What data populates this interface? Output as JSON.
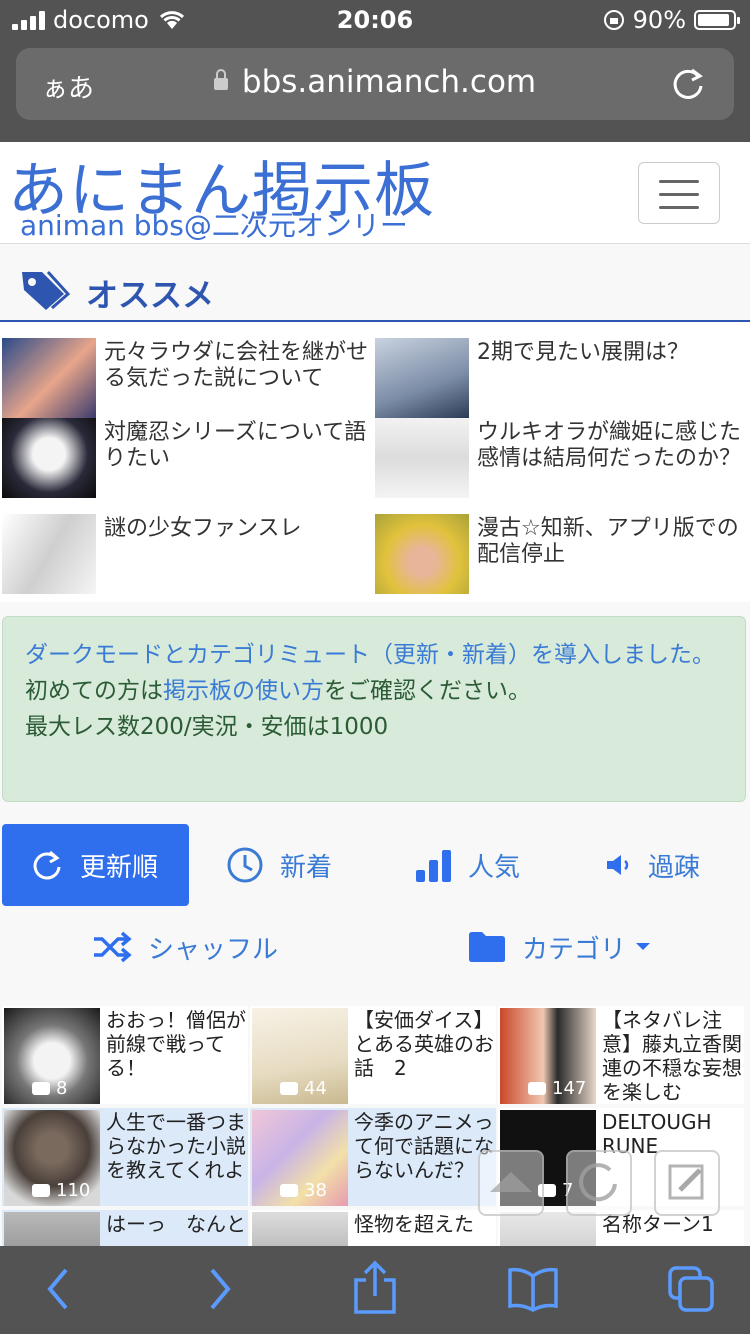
{
  "status": {
    "carrier": "docomo",
    "time": "20:06",
    "battery": "90%",
    "battery_level": 0.9
  },
  "safari": {
    "aa": "ぁあ",
    "url": "bbs.animanch.com"
  },
  "site": {
    "logo_ja": "あにまん掲示板",
    "logo_en": "animan bbs@二次元オンリー"
  },
  "recommended": {
    "heading": "オススメ",
    "items": [
      {
        "title": "元々ラウダに会社を継がせる気だった説について"
      },
      {
        "title": "2期で見たい展開は？"
      },
      {
        "title": "対魔忍シリーズについて語りたい"
      },
      {
        "title": "ウルキオラが織姫に感じた感情は結局何だったのか？"
      },
      {
        "title": "謎の少女ファンスレ"
      },
      {
        "title": "漫古☆知新、アプリ版での配信停止"
      }
    ]
  },
  "notice": {
    "line1": "ダークモードとカテゴリミュート（更新・新着）を導入しました。",
    "line2_pre": "初めての方は",
    "line2_link": "掲示板の使い方",
    "line2_post": "をご確認ください。",
    "line3": "最大レス数200/実況・安価は1000"
  },
  "sort": {
    "update": "更新順",
    "new": "新着",
    "popular": "人気",
    "sparse": "過疎",
    "shuffle": "シャッフル",
    "category": "カテゴリ"
  },
  "threads": [
    {
      "title": "おおっ！僧侶が前線で戦ってる！",
      "count": "8"
    },
    {
      "title": "【安価ダイス】とある英雄のお話　2",
      "count": "44"
    },
    {
      "title": "【ネタバレ注意】藤丸立香関連の不穏な妄想を楽しむ",
      "count": "147"
    },
    {
      "title": "人生で一番つまらなかった小説を教えてくれよ",
      "count": "110"
    },
    {
      "title": "今季のアニメって何で話題にならないんだ？",
      "count": "38"
    },
    {
      "title": "DELTOUGH RUNE",
      "count": "7"
    },
    {
      "title": "はーっ　なんと",
      "count": ""
    },
    {
      "title": "怪物を超えた",
      "count": ""
    },
    {
      "title": "名称ターン1",
      "count": ""
    }
  ],
  "colors": {
    "brand": "#3b6fd4",
    "accent": "#2f6fee",
    "notice_bg": "#d8ead9"
  }
}
